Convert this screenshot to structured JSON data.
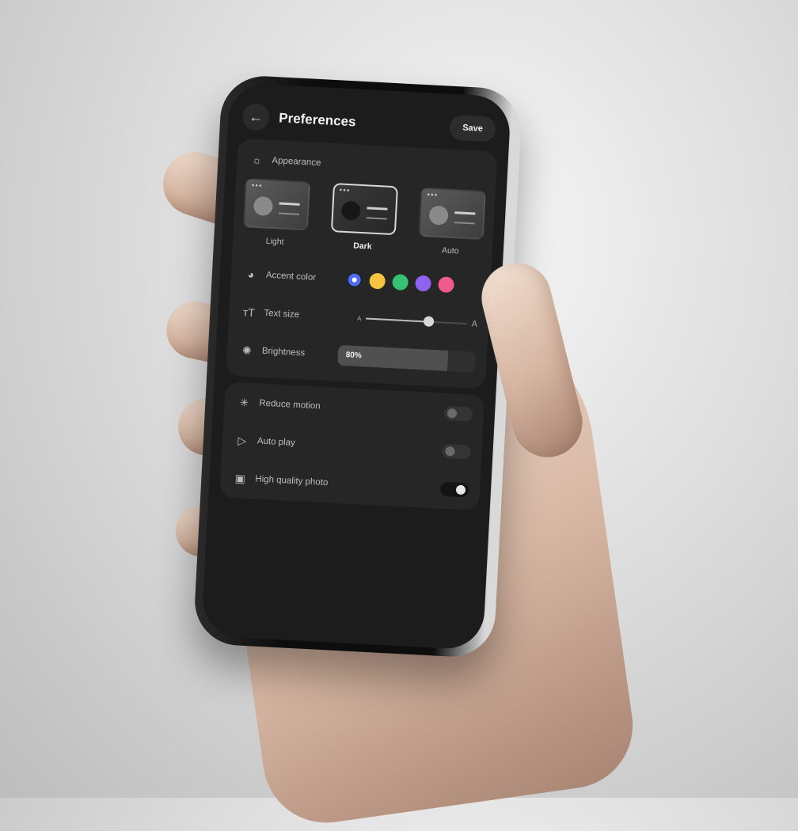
{
  "screen": {
    "title": "Preferences",
    "save_label": "Save",
    "back_icon": "arrow-left-icon"
  },
  "appearance": {
    "label": "Appearance",
    "icon": "sunrise-icon",
    "options": [
      {
        "label": "Light",
        "selected": false
      },
      {
        "label": "Dark",
        "selected": true
      },
      {
        "label": "Auto",
        "selected": false
      }
    ]
  },
  "accent_color": {
    "label": "Accent color",
    "icon": "palette-icon",
    "swatches": [
      "#4f6cf0",
      "#f5c542",
      "#38c172",
      "#8e63f0",
      "#f05a8c"
    ],
    "selected_index": 0
  },
  "text_size": {
    "label": "Text size",
    "icon": "text-size-icon",
    "min_label": "A",
    "max_label": "A",
    "value_fraction": 0.62
  },
  "brightness": {
    "label": "Brightness",
    "icon": "sun-icon",
    "value_text": "80%",
    "value": 0.8
  },
  "toggles": [
    {
      "label": "Reduce motion",
      "icon": "loader-icon",
      "on": false
    },
    {
      "label": "Auto play",
      "icon": "play-icon",
      "on": false
    },
    {
      "label": "High quality photo",
      "icon": "image-icon",
      "on": true
    }
  ]
}
